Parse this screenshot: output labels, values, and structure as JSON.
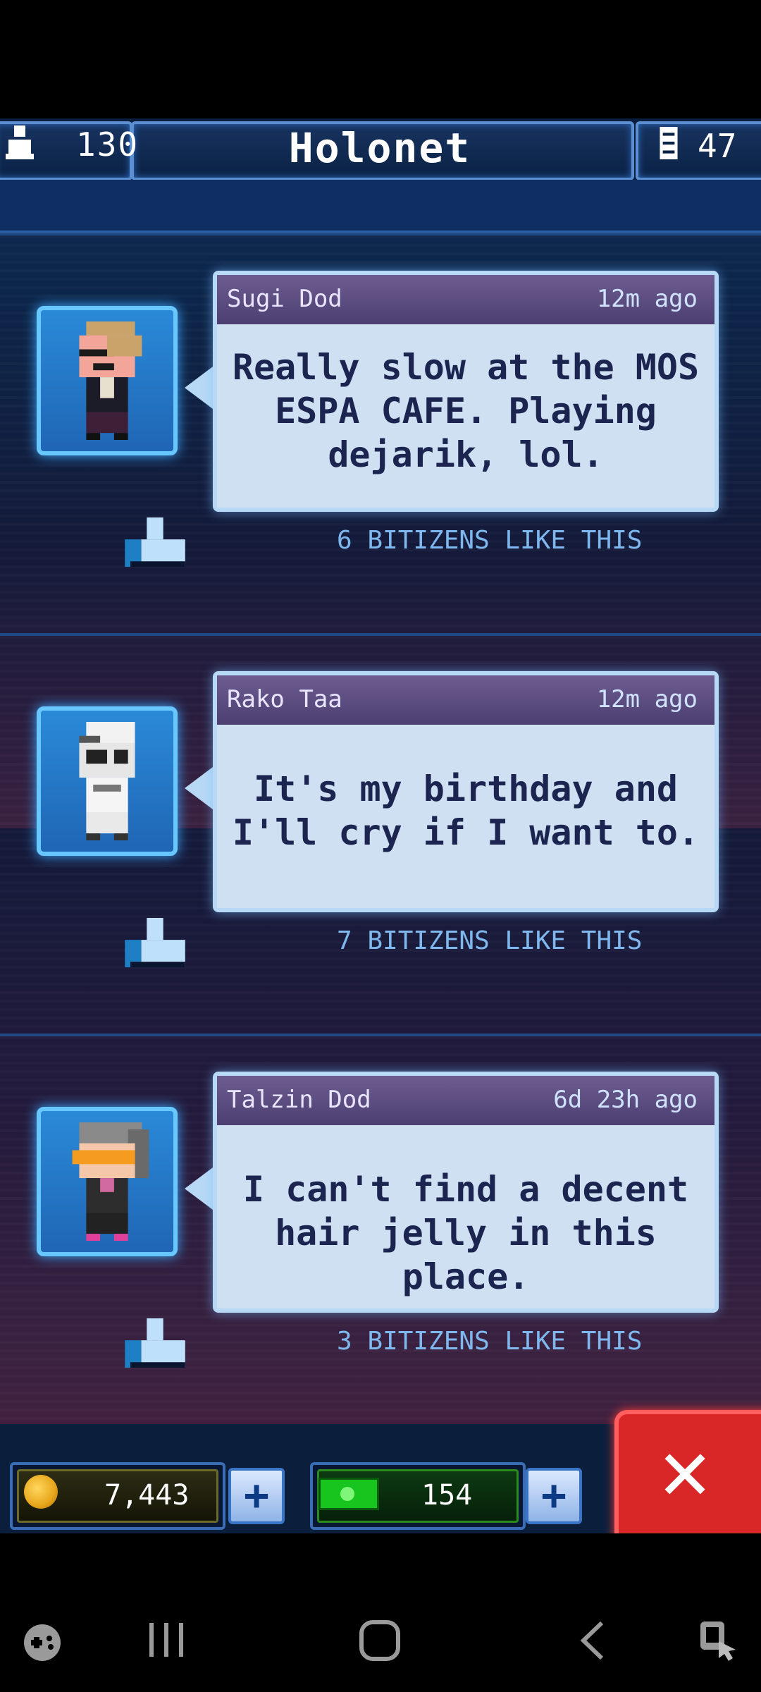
{
  "header": {
    "title": "Holonet",
    "population": "130",
    "floors": "47"
  },
  "posts": [
    {
      "author": "Sugi Dod",
      "time": "12m ago",
      "text": "Really slow at the MOS ESPA CAFE. Playing dejarik, lol.",
      "likes": "6 BITIZENS LIKE THIS"
    },
    {
      "author": "Rako Taa",
      "time": "12m ago",
      "text": "It's my birthday and I'll cry if I want to.",
      "likes": "7 BITIZENS LIKE THIS"
    },
    {
      "author": "Talzin Dod",
      "time": "6d 23h ago",
      "text": "I can't find a decent hair jelly in this place.",
      "likes": "3 BITIZENS LIKE THIS"
    }
  ],
  "resources": {
    "coins": "7,443",
    "bux": "154"
  },
  "colors": {
    "accent": "#69c7ff",
    "close": "#d92626"
  }
}
